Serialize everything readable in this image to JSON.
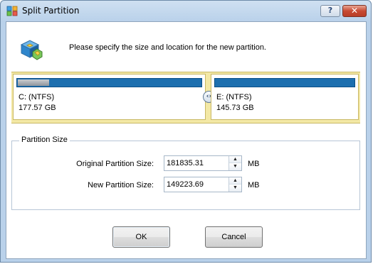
{
  "window": {
    "title": "Split Partition",
    "help_glyph": "?",
    "close_glyph": "✕",
    "icon": "partition-wizard-icon"
  },
  "header": {
    "instruction": "Please specify the size and location for the new partition.",
    "icon": "split-partition-icon"
  },
  "partitions": [
    {
      "name": "C: (NTFS)",
      "size": "177.57 GB",
      "used_fraction": 0.17
    },
    {
      "name": "E: (NTFS)",
      "size": "145.73 GB",
      "used_fraction": 0.0
    }
  ],
  "splitter": {
    "glyph": "‹›",
    "icon": "split-handle-icon"
  },
  "partition_size": {
    "group_label": "Partition Size",
    "original": {
      "label": "Original Partition Size:",
      "value": "181835.31",
      "unit": "MB"
    },
    "new": {
      "label": "New Partition Size:",
      "value": "149223.69",
      "unit": "MB"
    }
  },
  "spin": {
    "up_glyph": "▲",
    "down_glyph": "▼"
  },
  "buttons": {
    "ok": "OK",
    "cancel": "Cancel"
  },
  "colors": {
    "title_gradient": "#b9d1ea",
    "partition_strip": "#f3e8a5",
    "partition_bar": "#1d6faf",
    "close_button": "#c74a33"
  }
}
